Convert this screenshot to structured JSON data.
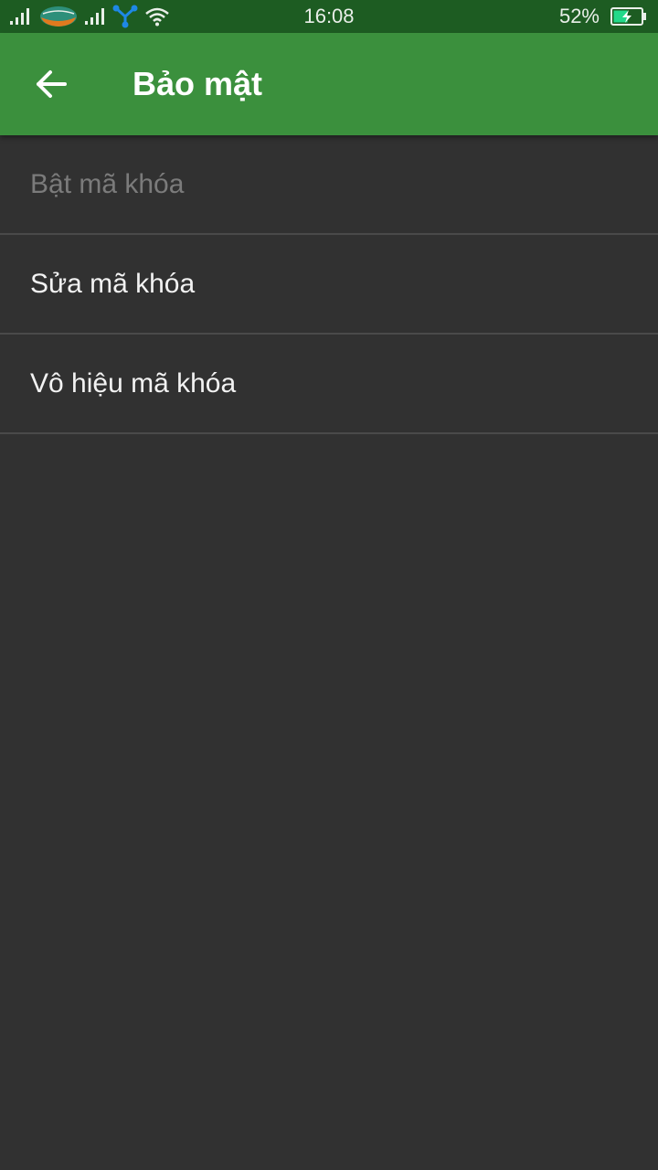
{
  "status_bar": {
    "time": "16:08",
    "battery_percent": "52%",
    "battery_level": 0.52,
    "icons": [
      "signal-icon",
      "carrier-logo-icon",
      "signal-icon",
      "data-transfer-icon",
      "wifi-icon",
      "battery-charging-icon"
    ]
  },
  "app_bar": {
    "title": "Bảo mật",
    "back_icon": "arrow-left-icon"
  },
  "menu": {
    "items": [
      {
        "label": "Bật mã khóa",
        "enabled": false
      },
      {
        "label": "Sửa mã khóa",
        "enabled": true
      },
      {
        "label": "Vô hiệu mã khóa",
        "enabled": true
      }
    ]
  },
  "colors": {
    "status_bar": "#1d5c22",
    "app_bar": "#3b903d",
    "background": "#313131",
    "divider": "#4a4a4a",
    "text_primary": "#f2f2f2",
    "text_disabled": "#7b7b7b"
  }
}
